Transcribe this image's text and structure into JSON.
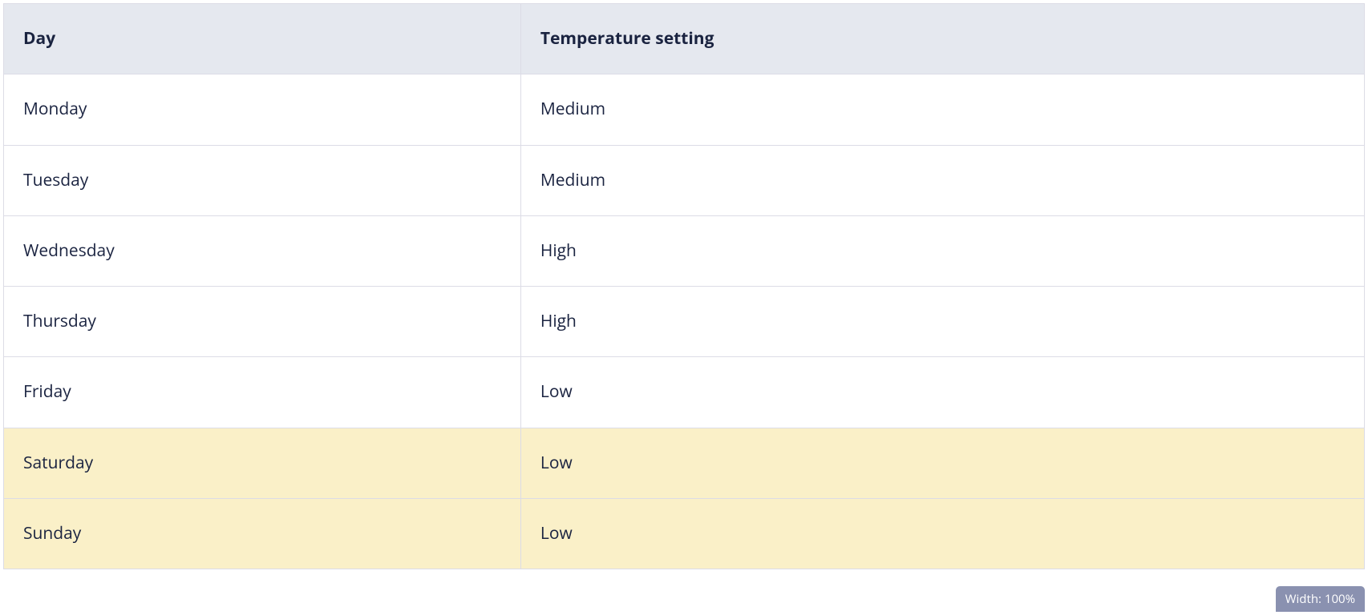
{
  "table": {
    "headers": {
      "day": "Day",
      "setting": "Temperature setting"
    },
    "rows": [
      {
        "day": "Monday",
        "setting": "Medium",
        "highlight": false
      },
      {
        "day": "Tuesday",
        "setting": "Medium",
        "highlight": false
      },
      {
        "day": "Wednesday",
        "setting": "High",
        "highlight": false
      },
      {
        "day": "Thursday",
        "setting": "High",
        "highlight": false
      },
      {
        "day": "Friday",
        "setting": "Low",
        "highlight": false
      },
      {
        "day": "Saturday",
        "setting": "Low",
        "highlight": true
      },
      {
        "day": "Sunday",
        "setting": "Low",
        "highlight": true
      }
    ]
  },
  "badge": {
    "label": "Width: 100%"
  }
}
